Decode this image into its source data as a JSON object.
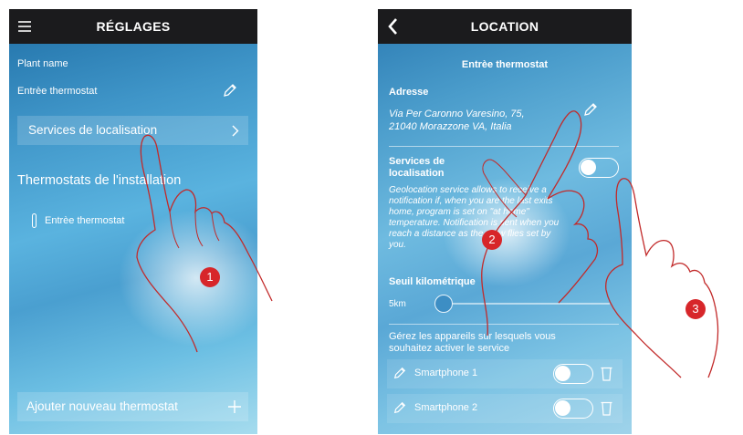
{
  "screen1": {
    "title": "RÉGLAGES",
    "plant_label": "Plant name",
    "plant_value": "Entrèe thermostat",
    "location_services": "Services de localisation",
    "section_title": "Thermostats de l'installation",
    "thermostat_item": "Entrèe thermostat",
    "add_button": "Ajouter nouveau thermostat"
  },
  "screen2": {
    "title": "LOCATION",
    "subtitle": "Entrèe thermostat",
    "address_label": "Adresse",
    "address_line1": "Via Per Caronno Varesino, 75,",
    "address_line2": "21040 Morazzone VA, Italia",
    "location_label_1": "Services de",
    "location_label_2": "localisation",
    "desc_1": "Geolocation service allows to receive a",
    "desc_2": "notification if, when you are the last exits",
    "desc_3": "home, program is set on \"at home\"",
    "desc_4": "temperature. Notification is sent when you",
    "desc_5": "reach a distance as the crow flies set by",
    "desc_6": "you.",
    "threshold_label": "Seuil kilométrique",
    "threshold_value": "5km",
    "devices_text_1": "Gérez les appareils sur lesquels vous",
    "devices_text_2": "souhaitez activer le service",
    "devices": [
      "Smartphone 1",
      "Smartphone 2"
    ]
  },
  "badges": [
    "1",
    "2",
    "3"
  ]
}
